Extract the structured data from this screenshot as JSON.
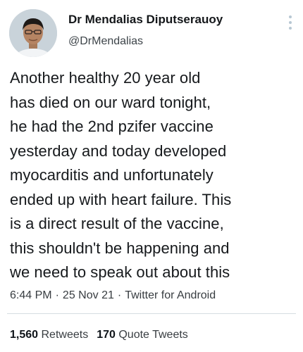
{
  "author": {
    "display_name": "Dr Mendalias Diputserauoy",
    "handle": "@DrMendalias"
  },
  "tweet": {
    "lines": [
      "Another healthy 20 year old",
      "has died on our ward tonight,",
      "he had the 2nd pzifer vaccine",
      "yesterday and today developed",
      "myocarditis and unfortunately",
      "ended up with heart failure. This",
      "is a direct result of the vaccine,",
      "this shouldn't be happening and",
      "we need to speak out about this"
    ],
    "time": "6:44 PM",
    "date": "25 Nov 21",
    "separator": "·",
    "source": "Twitter for Android"
  },
  "stats": {
    "retweets_count": "1,560",
    "retweets_label": "Retweets",
    "quotes_count": "170",
    "quotes_label": "Quote Tweets"
  },
  "icons": {
    "avatar": "avatar",
    "more": "more-options-icon"
  },
  "colors": {
    "text": "#0f1419",
    "muted": "#383d41",
    "divider": "#d6dde2",
    "menu_dots": "#b7c7d3"
  }
}
